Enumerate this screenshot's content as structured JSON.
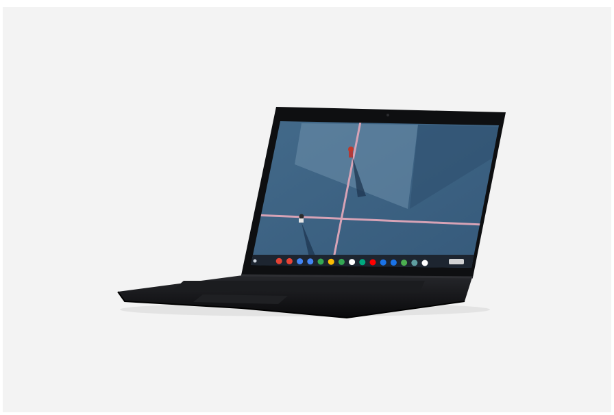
{
  "image": {
    "subject": "laptop",
    "colors": {
      "page_background": "#ffffff",
      "frame_background": "#f3f3f3",
      "laptop_body": "#121316",
      "screen_wallpaper": "#3e6382",
      "court_lines": "#d7a3b6",
      "shelf": "#1d2530"
    },
    "shelf_icons": [
      {
        "name": "launcher-icon",
        "color": "#cfd6df"
      },
      {
        "name": "chrome-icon",
        "color": "#e34234"
      },
      {
        "name": "gmail-icon",
        "color": "#ea4335"
      },
      {
        "name": "calendar-icon",
        "color": "#4285f4"
      },
      {
        "name": "docs-icon",
        "color": "#4285f4"
      },
      {
        "name": "sheets-icon",
        "color": "#34a853"
      },
      {
        "name": "slides-icon",
        "color": "#fbbc04"
      },
      {
        "name": "drive-icon",
        "color": "#34a853"
      },
      {
        "name": "camera-icon",
        "color": "#ffffff"
      },
      {
        "name": "play-store-icon",
        "color": "#00a97f"
      },
      {
        "name": "youtube-icon",
        "color": "#ff0000"
      },
      {
        "name": "messages-icon",
        "color": "#1a73e8"
      },
      {
        "name": "files-icon",
        "color": "#1a73e8"
      },
      {
        "name": "maps-icon",
        "color": "#4caf50"
      },
      {
        "name": "settings-icon",
        "color": "#5f9ea0"
      },
      {
        "name": "assistant-icon",
        "color": "#ffffff"
      }
    ]
  }
}
